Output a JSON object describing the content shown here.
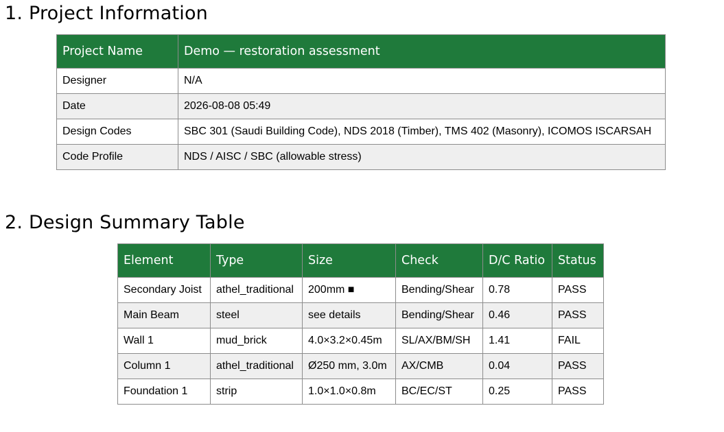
{
  "section1": {
    "title": "1. Project Information",
    "rows": [
      {
        "label": "Project Name",
        "value": "Demo — restoration assessment"
      },
      {
        "label": "Designer",
        "value": "N/A"
      },
      {
        "label": "Date",
        "value": "2026-08-08 05:49"
      },
      {
        "label": "Design Codes",
        "value": "SBC 301 (Saudi Building Code), NDS 2018 (Timber), TMS 402 (Masonry), ICOMOS ISCARSAH"
      },
      {
        "label": "Code Profile",
        "value": "NDS / AISC / SBC (allowable stress)"
      }
    ]
  },
  "section2": {
    "title": "2. Design Summary Table",
    "headers": [
      "Element",
      "Type",
      "Size",
      "Check",
      "D/C Ratio",
      "Status"
    ],
    "rows": [
      [
        "Secondary Joist",
        "athel_traditional",
        "200mm ■",
        "Bending/Shear",
        "0.78",
        "PASS"
      ],
      [
        "Main Beam",
        "steel",
        "see details",
        "Bending/Shear",
        "0.46",
        "PASS"
      ],
      [
        "Wall 1",
        "mud_brick",
        "4.0×3.2×0.45m",
        "SL/AX/BM/SH",
        "1.41",
        "FAIL"
      ],
      [
        "Column 1",
        "athel_traditional",
        "Ø250 mm, 3.0m",
        "AX/CMB",
        "0.04",
        "PASS"
      ],
      [
        "Foundation 1",
        "strip",
        "1.0×1.0×0.8m",
        "BC/EC/ST",
        "0.25",
        "PASS"
      ]
    ]
  },
  "colors": {
    "header_bg": "#1f7a3b",
    "header_text": "#ffffff",
    "alt_row_bg": "#efefef",
    "border": "#8c8c8c"
  }
}
